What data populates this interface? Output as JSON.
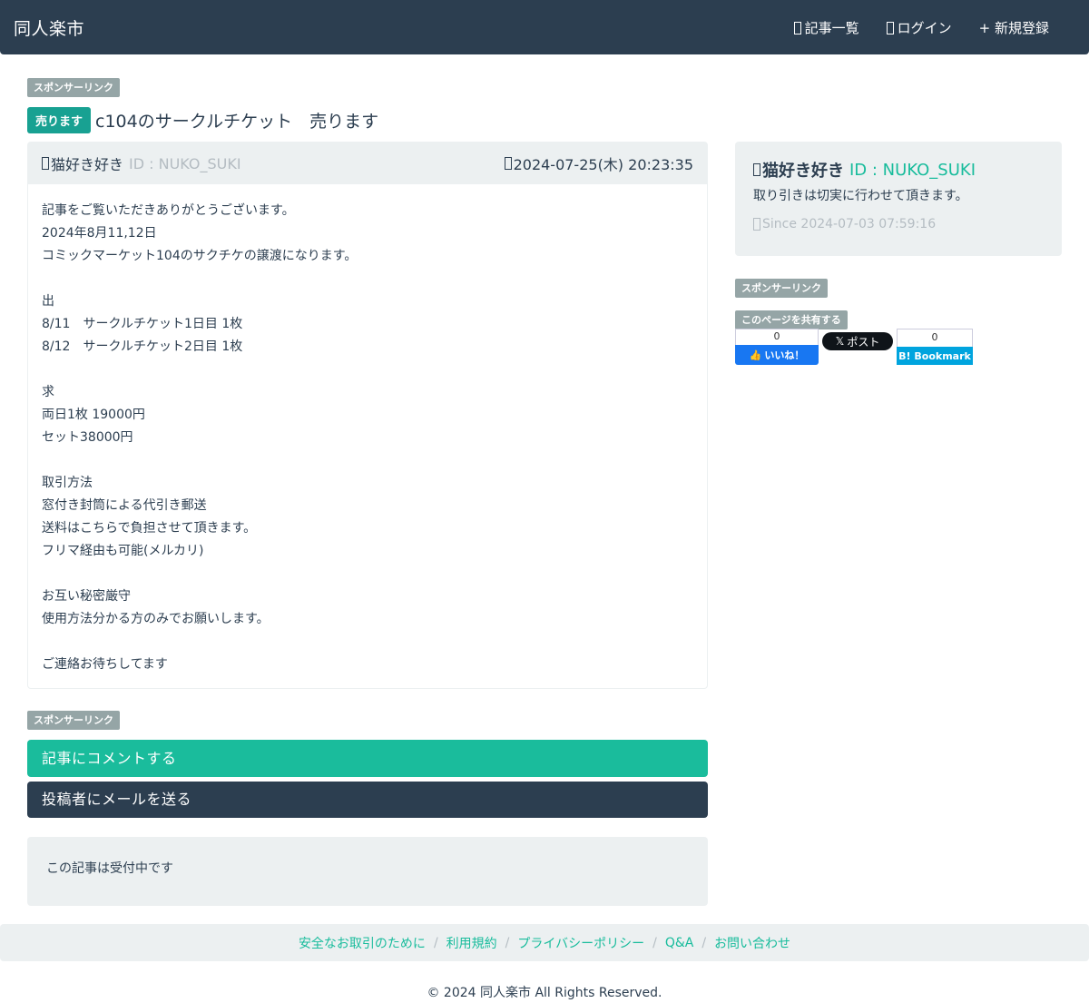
{
  "navbar": {
    "brand": "同人楽市",
    "items": [
      {
        "icon": "list-icon",
        "label": "記事一覧"
      },
      {
        "icon": "login-icon",
        "label": "ログイン"
      },
      {
        "icon": "plus-icon",
        "label": "+ 新規登録"
      }
    ]
  },
  "sponsor_label": "スポンサーリンク",
  "post": {
    "badge": "売ります",
    "title": "c104のサークルチケット　売ります",
    "author": "猫好き好き",
    "author_id": "ID : NUKO_SUKI",
    "date": "2024-07-25(木) 20:23:35",
    "body_lines": [
      "記事をご覧いただきありがとうございます。",
      "2024年8月11,12日",
      "コミックマーケット104のサクチケの譲渡になります。",
      "",
      "出",
      "8/11　サークルチケット1日目 1枚",
      "8/12　サークルチケット2日目 1枚",
      "",
      "求",
      "両日1枚 19000円",
      "セット38000円",
      "",
      "取引方法",
      "窓付き封筒による代引き郵送",
      "送料はこちらで負担させて頂きます。",
      "フリマ経由も可能(メルカリ)",
      "",
      "お互い秘密厳守",
      "使用方法分かる方のみでお願いします。",
      "",
      "ご連絡お待ちしてます"
    ]
  },
  "actions": {
    "comment": "記事にコメントする",
    "mail": "投稿者にメールを送る"
  },
  "status": "この記事は受付中です",
  "profile": {
    "name": "猫好き好き",
    "id": "ID : NUKO_SUKI",
    "bio": "取り引きは切実に行わせて頂きます。",
    "since": "Since 2024-07-03 07:59:16"
  },
  "share": {
    "label": "このページを共有する",
    "fb_count": "0",
    "fb_label": "いいね！",
    "x_label": "ポスト",
    "hb_count": "0",
    "hb_label": "B! Bookmark"
  },
  "footer": {
    "links": [
      "安全なお取引のために",
      "利用規約",
      "プライバシーポリシー",
      "Q&A",
      "お問い合わせ"
    ],
    "copyright": "© 2024 同人楽市 All Rights Reserved."
  },
  "colors": {
    "navbar": "#2c3e50",
    "accent": "#1abc9c",
    "badge": "#18a192",
    "muted": "#95a5a6",
    "well": "#ecf0f1"
  }
}
